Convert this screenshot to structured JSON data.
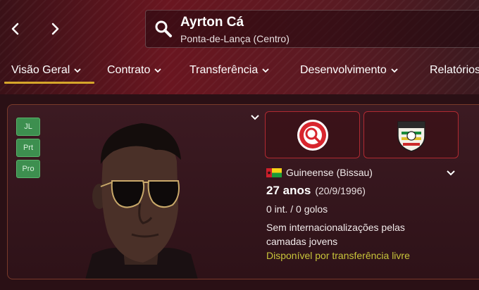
{
  "header": {
    "back_icon": "chevron-left-icon",
    "forward_icon": "chevron-right-icon",
    "search": {
      "icon": "search-icon",
      "player_name": "Ayrton Cá",
      "player_position": "Ponta-de-Lança (Centro)"
    }
  },
  "tabs": [
    {
      "label": "Visão Geral",
      "active": true
    },
    {
      "label": "Contrato",
      "active": false
    },
    {
      "label": "Transferência",
      "active": false
    },
    {
      "label": "Desenvolvimento",
      "active": false
    },
    {
      "label": "Relatórios",
      "active": false
    }
  ],
  "profile": {
    "role_badges": [
      "JL",
      "Prt",
      "Pro"
    ],
    "club_logo": "club-badge-icon",
    "nation_logo": "nation-crest-icon",
    "nationality": "Guineense (Bissau)",
    "age": "27 anos",
    "dob": "(20/9/1996)",
    "caps": "0 int. / 0 golos",
    "youth_caps": "Sem internacionalizações pelas camadas jovens",
    "transfer_status": "Disponível por transferência livre"
  },
  "colors": {
    "accent_underline": "#d6a62a",
    "badge_green": "#3d8f4f",
    "transfer_text": "#c8c43a",
    "card_border": "#7a3a2a",
    "logo_border": "#b02a32"
  }
}
